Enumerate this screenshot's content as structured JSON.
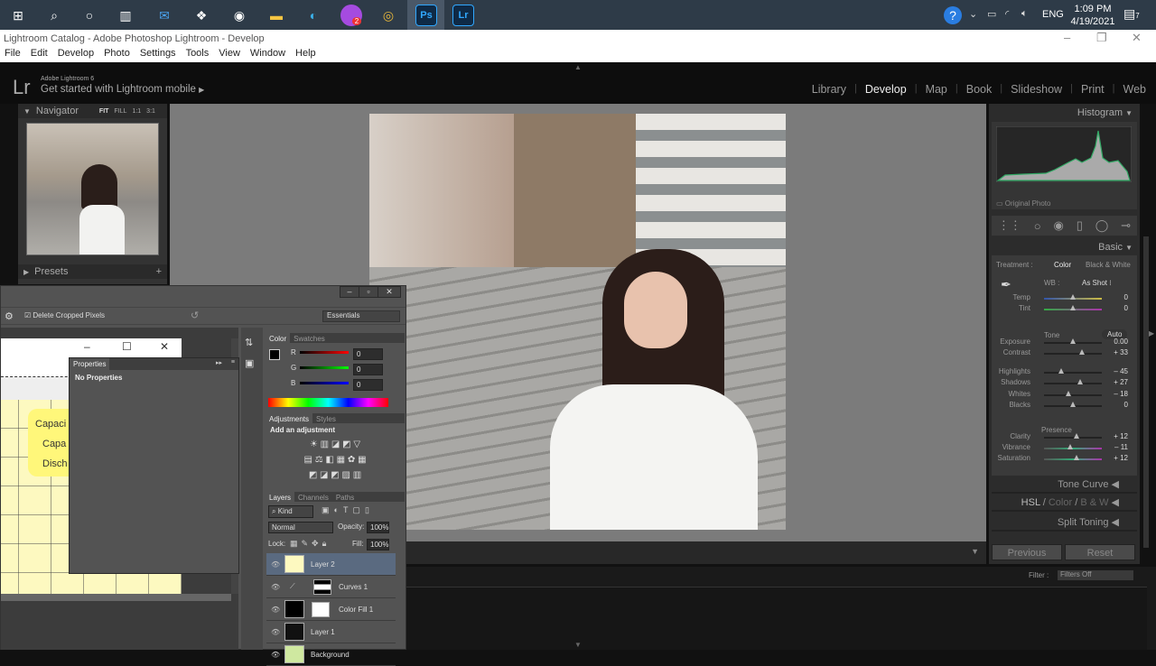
{
  "taskbar": {
    "icons": [
      "windows-start-icon",
      "search-icon",
      "cortana-icon",
      "task-view-icon",
      "mail-icon",
      "dropbox-icon",
      "app-icon",
      "file-explorer-icon",
      "edge-icon",
      "messenger-icon",
      "chrome-icon",
      "photoshop-icon",
      "lightroom-icon"
    ],
    "messenger_badge": "2",
    "ps_label": "Ps",
    "lr_label": "Lr",
    "lang": "ENG",
    "time": "1:09 PM",
    "date": "4/19/2021",
    "notif_count": "7"
  },
  "lr": {
    "window_title": "Lightroom Catalog - Adobe Photoshop Lightroom - Develop",
    "menu": [
      "File",
      "Edit",
      "Develop",
      "Photo",
      "Settings",
      "Tools",
      "View",
      "Window",
      "Help"
    ],
    "logo": "Lr",
    "version": "Adobe Lightroom 6",
    "mobile": "Get started with Lightroom mobile",
    "modules": [
      "Library",
      "Develop",
      "Map",
      "Book",
      "Slideshow",
      "Print",
      "Web"
    ],
    "active_module": "Develop",
    "navigator": {
      "title": "Navigator",
      "zoom": [
        "FIT",
        "FILL",
        "1:1",
        "3:1"
      ]
    },
    "presets": {
      "title": "Presets"
    },
    "histogram": {
      "title": "Histogram",
      "original_photo": "Original Photo"
    },
    "basic": {
      "title": "Basic",
      "treatment_label": "Treatment :",
      "treatment_color": "Color",
      "treatment_bw": "Black & White",
      "wb_label": "WB :",
      "wb_value": "As Shot",
      "tone": "Tone",
      "auto": "Auto",
      "presence": "Presence",
      "sliders": [
        {
          "label": "Temp",
          "value": "0",
          "pos": 0.5
        },
        {
          "label": "Tint",
          "value": "0",
          "pos": 0.5
        },
        {
          "label": "Exposure",
          "value": "0.00",
          "pos": 0.5
        },
        {
          "label": "Contrast",
          "value": "+ 33",
          "pos": 0.66
        },
        {
          "label": "Highlights",
          "value": "– 45",
          "pos": 0.3
        },
        {
          "label": "Shadows",
          "value": "+ 27",
          "pos": 0.63
        },
        {
          "label": "Whites",
          "value": "– 18",
          "pos": 0.42
        },
        {
          "label": "Blacks",
          "value": "0",
          "pos": 0.5
        },
        {
          "label": "Clarity",
          "value": "+ 12",
          "pos": 0.56
        },
        {
          "label": "Vibrance",
          "value": "– 11",
          "pos": 0.45
        },
        {
          "label": "Saturation",
          "value": "+ 12",
          "pos": 0.56
        }
      ]
    },
    "panels": {
      "tone_curve": "Tone Curve",
      "hsl": "HSL",
      "color": "Color",
      "bw": "B & W",
      "split_toning": "Split Toning"
    },
    "buttons": {
      "previous": "Previous",
      "reset": "Reset"
    },
    "filter": {
      "label": "Filter :",
      "value": "Filters Off"
    }
  },
  "ps": {
    "delete_cropped": "Delete Cropped Pixels",
    "workspace": "Essentials",
    "properties": {
      "tab": "Properties",
      "content": "No Properties"
    },
    "color": {
      "tabs": [
        "Color",
        "Swatches"
      ],
      "r": "0",
      "g": "0",
      "b": "0"
    },
    "adjustments": {
      "tabs": [
        "Adjustments",
        "Styles"
      ],
      "hint": "Add an adjustment"
    },
    "layers": {
      "tabs": [
        "Layers",
        "Channels",
        "Paths"
      ],
      "kind": "Kind",
      "blend": "Normal",
      "opacity_label": "Opacity:",
      "opacity": "100%",
      "lock_label": "Lock:",
      "fill_label": "Fill:",
      "fill": "100%",
      "items": [
        "Layer 2",
        "Curves 1",
        "Color Fill 1",
        "Layer 1",
        "Background"
      ]
    },
    "doc_text": [
      "Capaci",
      "Capa",
      "Disch"
    ]
  }
}
